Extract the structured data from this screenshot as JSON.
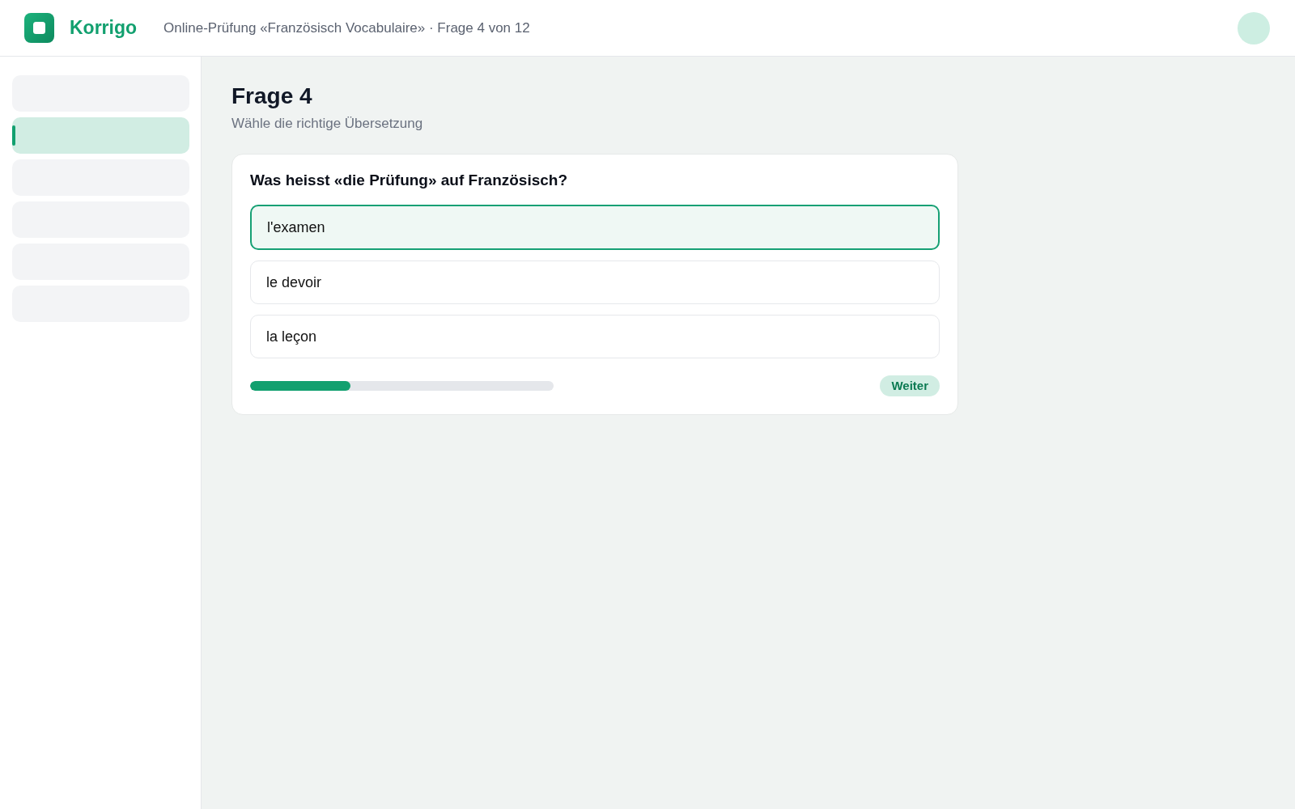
{
  "header": {
    "brand": "Korrigo",
    "breadcrumb": "Online-Prüfung «Französisch Vocabulaire» · Frage 4 von 12"
  },
  "sidebar": {
    "items": [
      {
        "selected": false
      },
      {
        "selected": true
      },
      {
        "selected": false
      },
      {
        "selected": false
      },
      {
        "selected": false
      },
      {
        "selected": false
      }
    ]
  },
  "page": {
    "title": "Frage 4",
    "subtitle": "Wähle die richtige Übersetzung"
  },
  "question": {
    "prompt": "Was heisst «die Prüfung» auf Französisch?",
    "options": [
      {
        "label": "l'examen",
        "selected": true
      },
      {
        "label": "le devoir",
        "selected": false
      },
      {
        "label": "la leçon",
        "selected": false
      }
    ],
    "progress": {
      "level": 0.33
    },
    "next_button": "Weiter"
  }
}
